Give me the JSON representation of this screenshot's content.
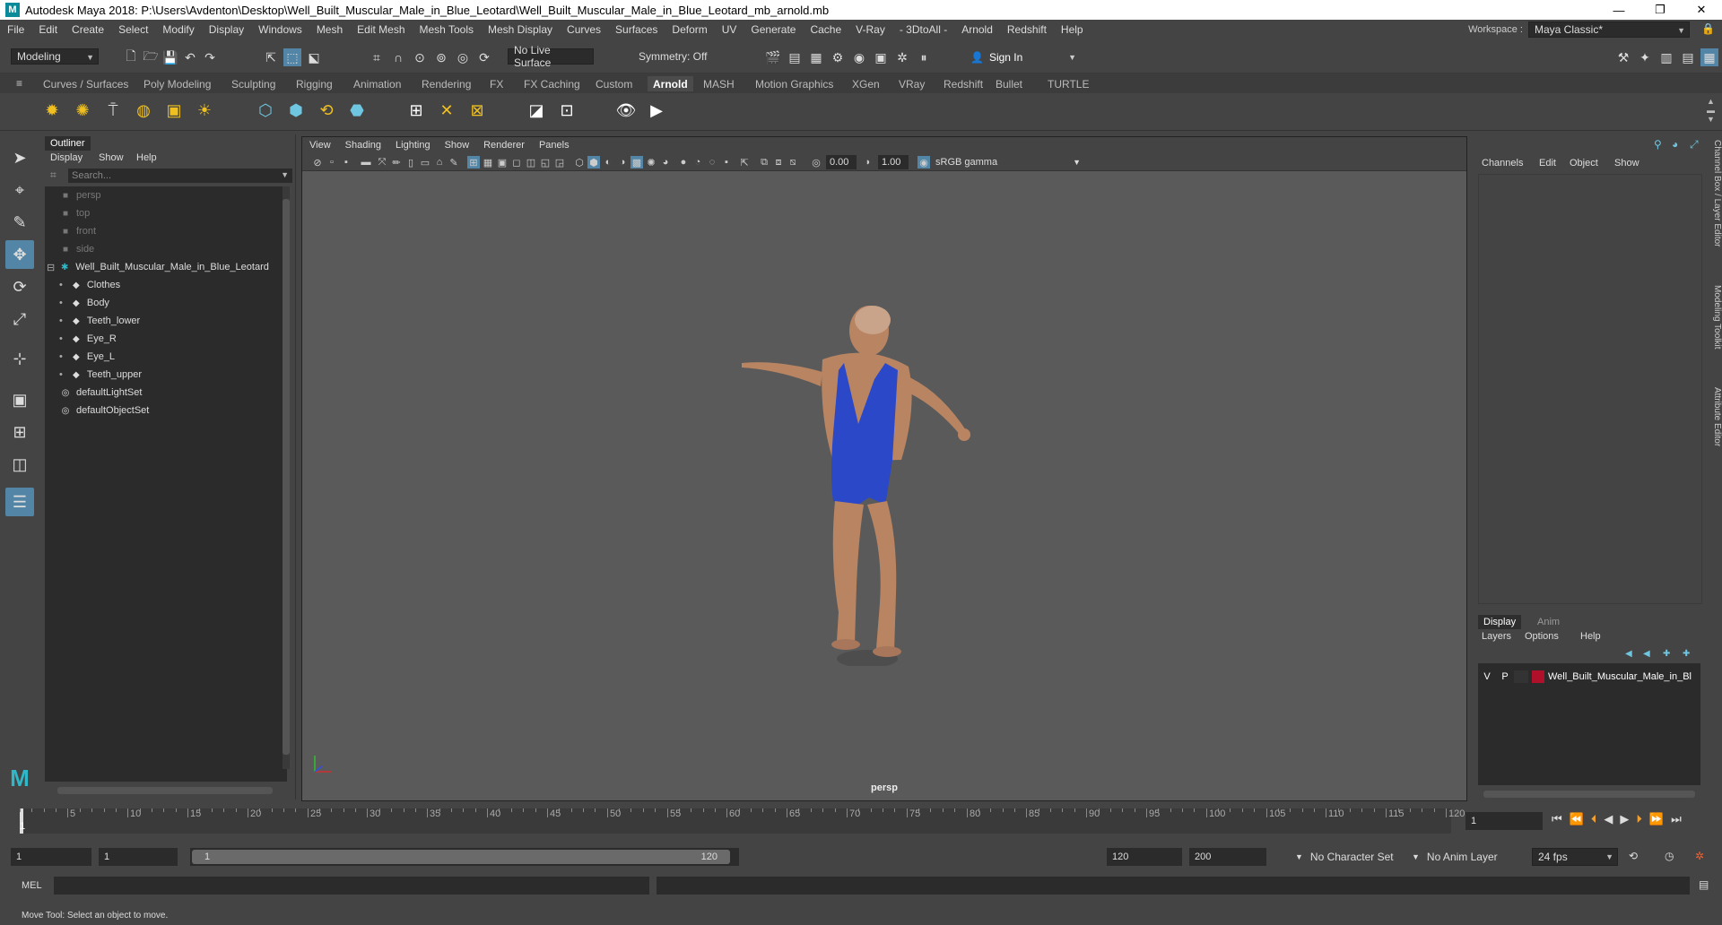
{
  "title": "Autodesk Maya 2018: P:\\Users\\Avdenton\\Desktop\\Well_Built_Muscular_Male_in_Blue_Leotard\\Well_Built_Muscular_Male_in_Blue_Leotard_mb_arnold.mb",
  "window_buttons": [
    "—",
    "❐",
    "✕"
  ],
  "menu": [
    "File",
    "Edit",
    "Create",
    "Select",
    "Modify",
    "Display",
    "Windows",
    "Mesh",
    "Edit Mesh",
    "Mesh Tools",
    "Mesh Display",
    "Curves",
    "Surfaces",
    "Deform",
    "UV",
    "Generate",
    "Cache",
    "V-Ray",
    "- 3DtoAll -",
    "Arnold",
    "Redshift",
    "Help"
  ],
  "workspace": {
    "label": "Workspace :",
    "value": "Maya Classic*"
  },
  "statusline": {
    "mode": "Modeling",
    "live_surface": "No Live Surface",
    "symmetry": "Symmetry: Off",
    "sign_in": "Sign In"
  },
  "shelf_tabs": [
    "Curves / Surfaces",
    "Poly Modeling",
    "Sculpting",
    "Rigging",
    "Animation",
    "Rendering",
    "FX",
    "FX Caching",
    "Custom",
    "Arnold",
    "MASH",
    "Motion Graphics",
    "XGen",
    "VRay",
    "Redshift",
    "Bullet",
    "TURTLE"
  ],
  "active_shelf": "Arnold",
  "outliner": {
    "tab": "Outliner",
    "menu": [
      "Display",
      "Show",
      "Help"
    ],
    "search_placeholder": "Search...",
    "items": [
      {
        "label": "persp",
        "icon": "camera-icon",
        "dim": true,
        "indent": 0
      },
      {
        "label": "top",
        "icon": "camera-icon",
        "dim": true,
        "indent": 0
      },
      {
        "label": "front",
        "icon": "camera-icon",
        "dim": true,
        "indent": 0
      },
      {
        "label": "side",
        "icon": "camera-icon",
        "dim": true,
        "indent": 0
      },
      {
        "label": "Well_Built_Muscular_Male_in_Blue_Leotard",
        "icon": "group-icon",
        "dim": false,
        "indent": 0
      },
      {
        "label": "Clothes",
        "icon": "mesh-icon",
        "dim": false,
        "indent": 1
      },
      {
        "label": "Body",
        "icon": "mesh-icon",
        "dim": false,
        "indent": 1
      },
      {
        "label": "Teeth_lower",
        "icon": "mesh-icon",
        "dim": false,
        "indent": 1
      },
      {
        "label": "Eye_R",
        "icon": "mesh-icon",
        "dim": false,
        "indent": 1
      },
      {
        "label": "Eye_L",
        "icon": "mesh-icon",
        "dim": false,
        "indent": 1
      },
      {
        "label": "Teeth_upper",
        "icon": "mesh-icon",
        "dim": false,
        "indent": 1
      },
      {
        "label": "defaultLightSet",
        "icon": "set-icon",
        "dim": false,
        "indent": 0
      },
      {
        "label": "defaultObjectSet",
        "icon": "set-icon",
        "dim": false,
        "indent": 0
      }
    ]
  },
  "viewport": {
    "menu": [
      "View",
      "Shading",
      "Lighting",
      "Show",
      "Renderer",
      "Panels"
    ],
    "exposure": "0.00",
    "gamma": "1.00",
    "color_space": "sRGB gamma",
    "camera_label": "persp"
  },
  "channelbox": {
    "menu": [
      "Channels",
      "Edit",
      "Object",
      "Show"
    ],
    "layer_tabs": [
      "Display",
      "Anim"
    ],
    "layer_menu": [
      "Layers",
      "Options",
      "Help"
    ],
    "layer": {
      "v": "V",
      "p": "P",
      "name": "Well_Built_Muscular_Male_in_Blue_Leotard",
      "color": "#b0102a"
    }
  },
  "side_tabs": [
    "Channel Box / Layer Editor",
    "Modeling Toolkit",
    "Attribute Editor"
  ],
  "timeline": {
    "ticks": [
      "5",
      "10",
      "15",
      "20",
      "25",
      "30",
      "35",
      "40",
      "45",
      "50",
      "55",
      "60",
      "65",
      "70",
      "75",
      "80",
      "85",
      "90",
      "95",
      "100",
      "105",
      "110",
      "115",
      "120"
    ],
    "start_marker": "1",
    "current_frame": "1"
  },
  "range": {
    "start": "1",
    "playback_start": "1",
    "slider_start": "1",
    "slider_end": "120",
    "playback_end": "120",
    "end": "200",
    "character_set": "No Character Set",
    "anim_layer": "No Anim Layer",
    "fps": "24 fps"
  },
  "cmdline": {
    "label": "MEL"
  },
  "helpline": "Move Tool: Select an object to move."
}
